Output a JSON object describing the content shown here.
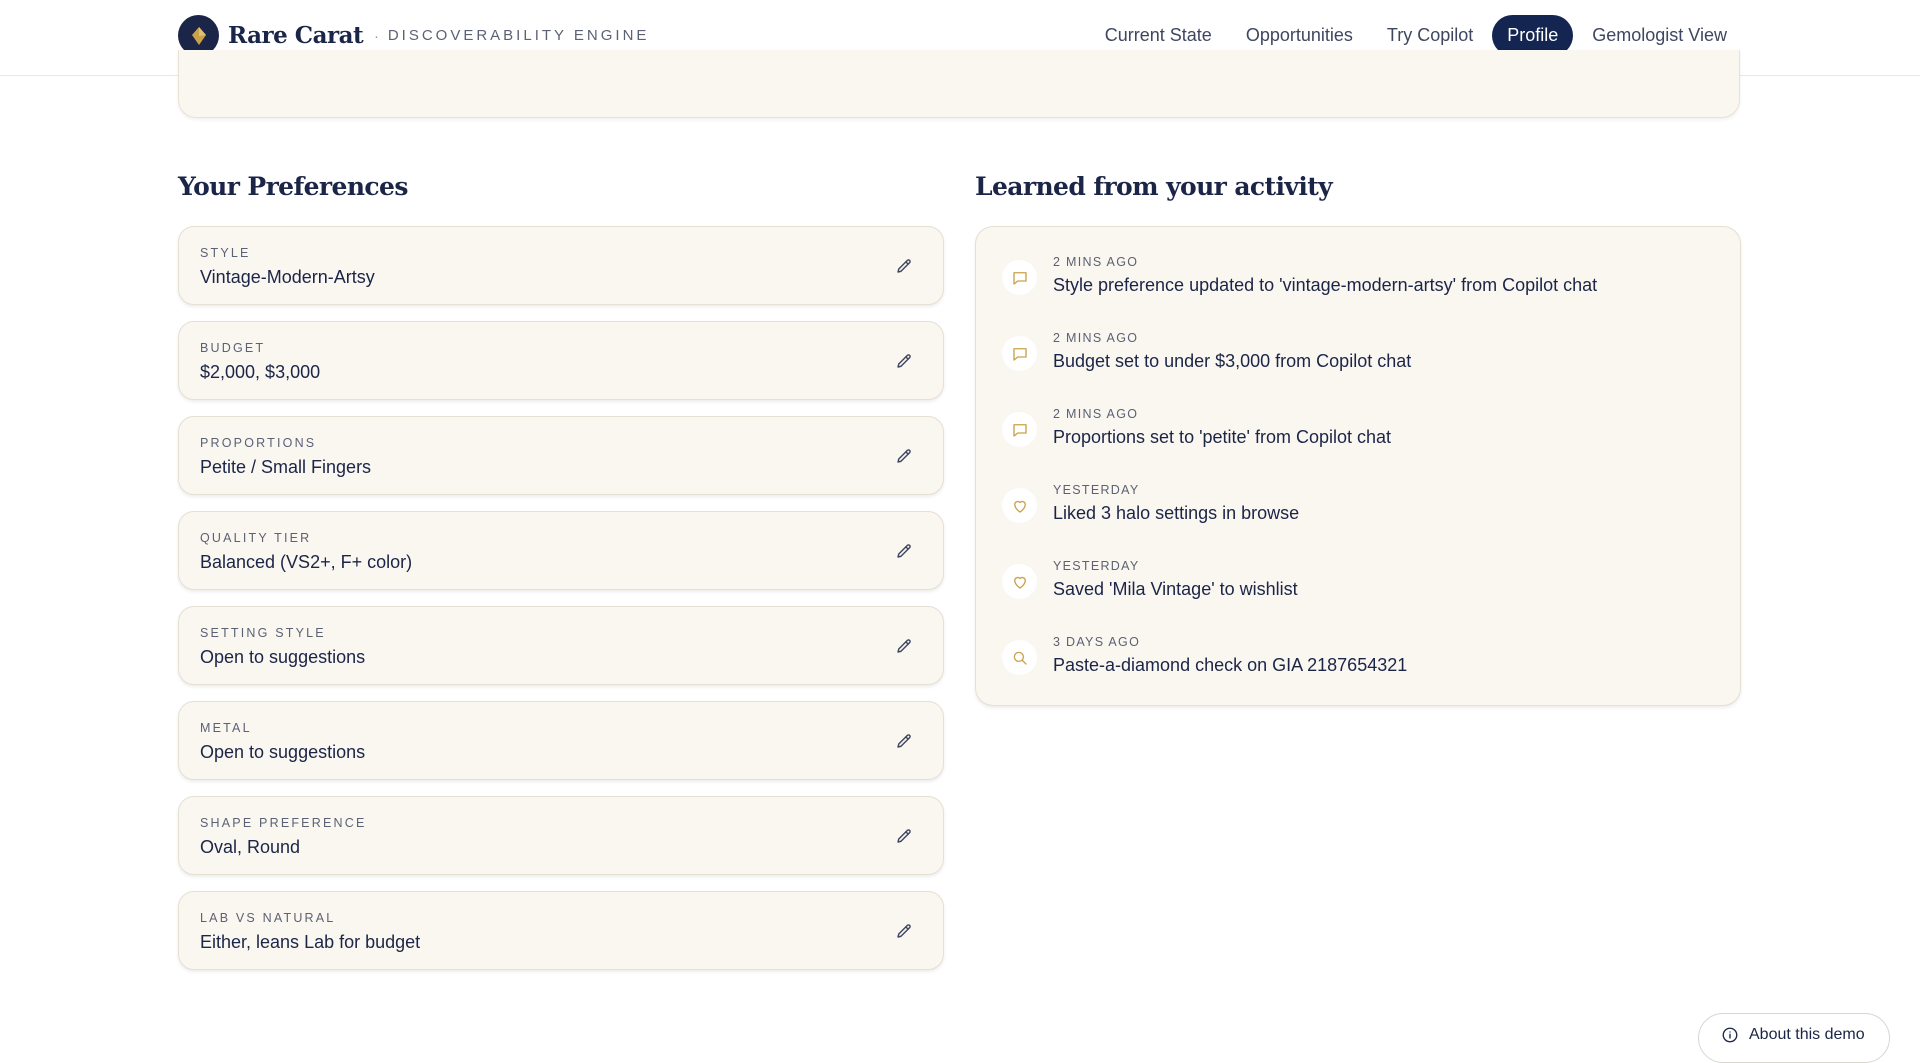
{
  "header": {
    "brand_name": "Rare Carat",
    "brand_separator": "·",
    "brand_tagline": "DISCOVERABILITY ENGINE",
    "nav": [
      {
        "label": "Current State",
        "active": false
      },
      {
        "label": "Opportunities",
        "active": false
      },
      {
        "label": "Try Copilot",
        "active": false
      },
      {
        "label": "Profile",
        "active": true
      },
      {
        "label": "Gemologist View",
        "active": false
      }
    ]
  },
  "preferences": {
    "title": "Your Preferences",
    "items": [
      {
        "label": "STYLE",
        "value": "Vintage-Modern-Artsy"
      },
      {
        "label": "BUDGET",
        "value": "$2,000, $3,000"
      },
      {
        "label": "PROPORTIONS",
        "value": "Petite / Small Fingers"
      },
      {
        "label": "QUALITY TIER",
        "value": "Balanced (VS2+, F+ color)"
      },
      {
        "label": "SETTING STYLE",
        "value": "Open to suggestions"
      },
      {
        "label": "METAL",
        "value": "Open to suggestions"
      },
      {
        "label": "SHAPE PREFERENCE",
        "value": "Oval, Round"
      },
      {
        "label": "LAB VS NATURAL",
        "value": "Either, leans Lab for budget"
      }
    ]
  },
  "activity": {
    "title": "Learned from your activity",
    "items": [
      {
        "icon": "chat-bubble-icon",
        "time": "2 MINS AGO",
        "text": "Style preference updated to 'vintage-modern-artsy' from Copilot chat"
      },
      {
        "icon": "chat-bubble-icon",
        "time": "2 MINS AGO",
        "text": "Budget set to under $3,000 from Copilot chat"
      },
      {
        "icon": "chat-bubble-icon",
        "time": "2 MINS AGO",
        "text": "Proportions set to 'petite' from Copilot chat"
      },
      {
        "icon": "heart-icon",
        "time": "YESTERDAY",
        "text": "Liked 3 halo settings in browse"
      },
      {
        "icon": "heart-icon",
        "time": "YESTERDAY",
        "text": "Saved 'Mila Vintage' to wishlist"
      },
      {
        "icon": "search-icon",
        "time": "3 DAYS AGO",
        "text": "Paste-a-diamond check on GIA 2187654321"
      }
    ]
  },
  "about_button": {
    "label": "About this demo",
    "icon": "info-icon"
  },
  "colors": {
    "navy": "#152552",
    "card_bg": "#faf6f0",
    "gold_accent": "#c9a24a"
  }
}
